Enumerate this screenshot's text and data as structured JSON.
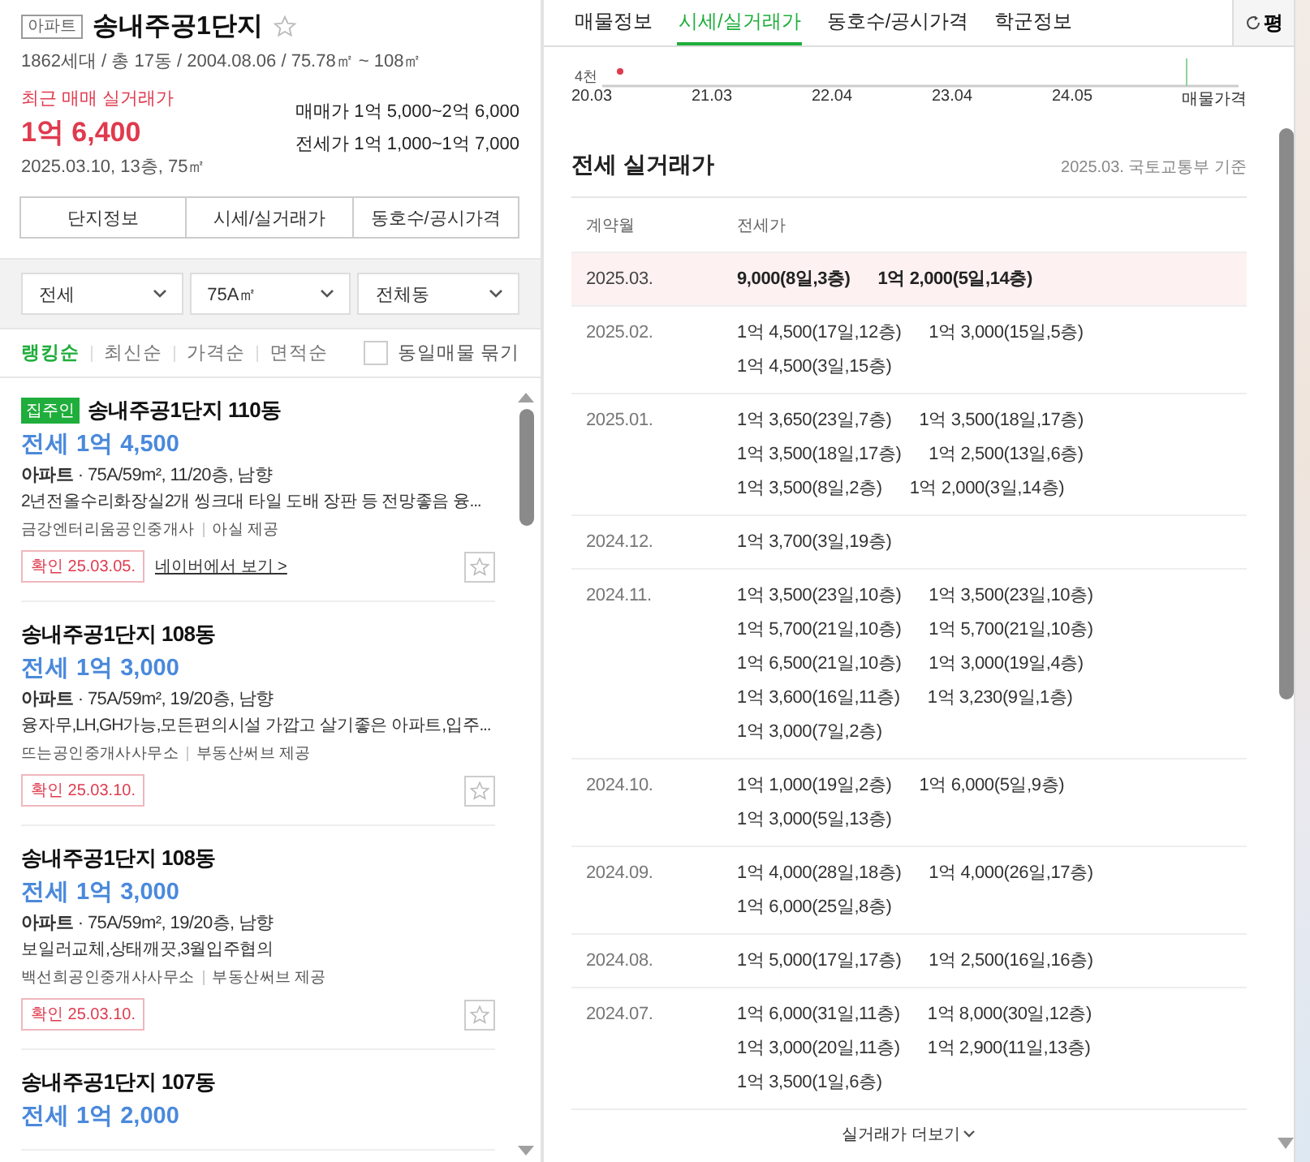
{
  "complex": {
    "type_tag": "아파트",
    "name": "송내주공1단지",
    "favorite": false,
    "summary": "1862세대 / 총 17동 / 2004.08.06 / 75.78㎡ ~ 108㎡",
    "recent_label": "최근 매매 실거래가",
    "recent_price": "1억 6,400",
    "recent_detail": "2025.03.10, 13층, 75㎡",
    "ranges": [
      {
        "label": "매매가",
        "value": "1억 5,000~2억 6,000"
      },
      {
        "label": "전세가",
        "value": "1억 1,000~1억 7,000"
      }
    ],
    "buttons": [
      "단지정보",
      "시세/실거래가",
      "동호수/공시가격"
    ]
  },
  "filters": [
    {
      "value": "전세"
    },
    {
      "value": "75A㎡"
    },
    {
      "value": "전체동"
    }
  ],
  "sort": {
    "options": [
      {
        "label": "랭킹순",
        "selected": true
      },
      {
        "label": "최신순",
        "selected": false
      },
      {
        "label": "가격순",
        "selected": false
      },
      {
        "label": "면적순",
        "selected": false
      }
    ],
    "group_label": "동일매물 묶기",
    "group_checked": false
  },
  "listings": [
    {
      "badge": "집주인",
      "title": "송내주공1단지 110동",
      "price": "전세 1억 4,500",
      "meta": "**아파트** · 75A/59m², 11/20층, 남향",
      "description": "2년전올수리화장실2개 씽크대 타일 도배 장판 등 전망좋음 융...",
      "agency": "금강엔터리움공인중개사",
      "source": "아실 제공",
      "confirmed": "확인 25.03.05.",
      "link": "네이버에서 보기 >",
      "favorite": false
    },
    {
      "title": "송내주공1단지 108동",
      "price": "전세 1억 3,000",
      "meta": "**아파트** · 75A/59m², 19/20층, 남향",
      "description": "융자무,LH,GH가능,모든편의시설 가깝고 살기좋은 아파트,입주...",
      "agency": "뜨는공인중개사사무소",
      "source": "부동산써브 제공",
      "confirmed": "확인 25.03.10.",
      "favorite": false
    },
    {
      "title": "송내주공1단지 108동",
      "price": "전세 1억 3,000",
      "meta": "**아파트** · 75A/59m², 19/20층, 남향",
      "description": "보일러교체,상태깨끗,3월입주협의",
      "agency": "백선희공인중개사사무소",
      "source": "부동산써브 제공",
      "confirmed": "확인 25.03.10.",
      "favorite": false
    },
    {
      "title": "송내주공1단지 107동",
      "price": "전세 1억 2,000"
    }
  ],
  "tabs": [
    {
      "label": "매물정보",
      "selected": false
    },
    {
      "label": "시세/실거래가",
      "selected": true
    },
    {
      "label": "동호수/공시가격",
      "selected": false
    },
    {
      "label": "학군정보",
      "selected": false
    }
  ],
  "unit_button": "평",
  "chart": {
    "y_label": "4천",
    "x_labels": [
      "20.03",
      "21.03",
      "22.04",
      "23.04",
      "24.05"
    ],
    "legend": "매물가격"
  },
  "deals": {
    "title": "전세 실거래가",
    "note": "2025.03. 국토교통부 기준",
    "columns": [
      "계약월",
      "전세가"
    ],
    "rows": [
      {
        "month": "2025.03.",
        "highlighted": true,
        "items": [
          "9,000(8일,3층)",
          "1억 2,000(5일,14층)"
        ]
      },
      {
        "month": "2025.02.",
        "highlighted": false,
        "items": [
          "1억 4,500(17일,12층)",
          "1억 3,000(15일,5층)",
          "1억 4,500(3일,15층)"
        ]
      },
      {
        "month": "2025.01.",
        "highlighted": false,
        "items": [
          "1억 3,650(23일,7층)",
          "1억 3,500(18일,17층)",
          "1억 3,500(18일,17층)",
          "1억 2,500(13일,6층)",
          "1억 3,500(8일,2층)",
          "1억 2,000(3일,14층)"
        ]
      },
      {
        "month": "2024.12.",
        "highlighted": false,
        "items": [
          "1억 3,700(3일,19층)"
        ]
      },
      {
        "month": "2024.11.",
        "highlighted": false,
        "items": [
          "1억 3,500(23일,10층)",
          "1억 3,500(23일,10층)",
          "1억 5,700(21일,10층)",
          "1억 5,700(21일,10층)",
          "1억 6,500(21일,10층)",
          "1억 3,000(19일,4층)",
          "1억 3,600(16일,11층)",
          "1억 3,230(9일,1층)",
          "1억 3,000(7일,2층)"
        ]
      },
      {
        "month": "2024.10.",
        "highlighted": false,
        "items": [
          "1억 1,000(19일,2층)",
          "1억 6,000(5일,9층)",
          "1억 3,000(5일,13층)"
        ]
      },
      {
        "month": "2024.09.",
        "highlighted": false,
        "items": [
          "1억 4,000(28일,18층)",
          "1억 4,000(26일,17층)",
          "1억 6,000(25일,8층)"
        ]
      },
      {
        "month": "2024.08.",
        "highlighted": false,
        "items": [
          "1억 5,000(17일,17층)",
          "1억 2,500(16일,16층)"
        ]
      },
      {
        "month": "2024.07.",
        "highlighted": false,
        "items": [
          "1억 6,000(31일,11층)",
          "1억 8,000(30일,12층)",
          "1억 3,000(20일,11층)",
          "1억 2,900(11일,13층)",
          "1억 3,500(1일,6층)"
        ]
      }
    ],
    "more": "실거래가 더보기"
  }
}
